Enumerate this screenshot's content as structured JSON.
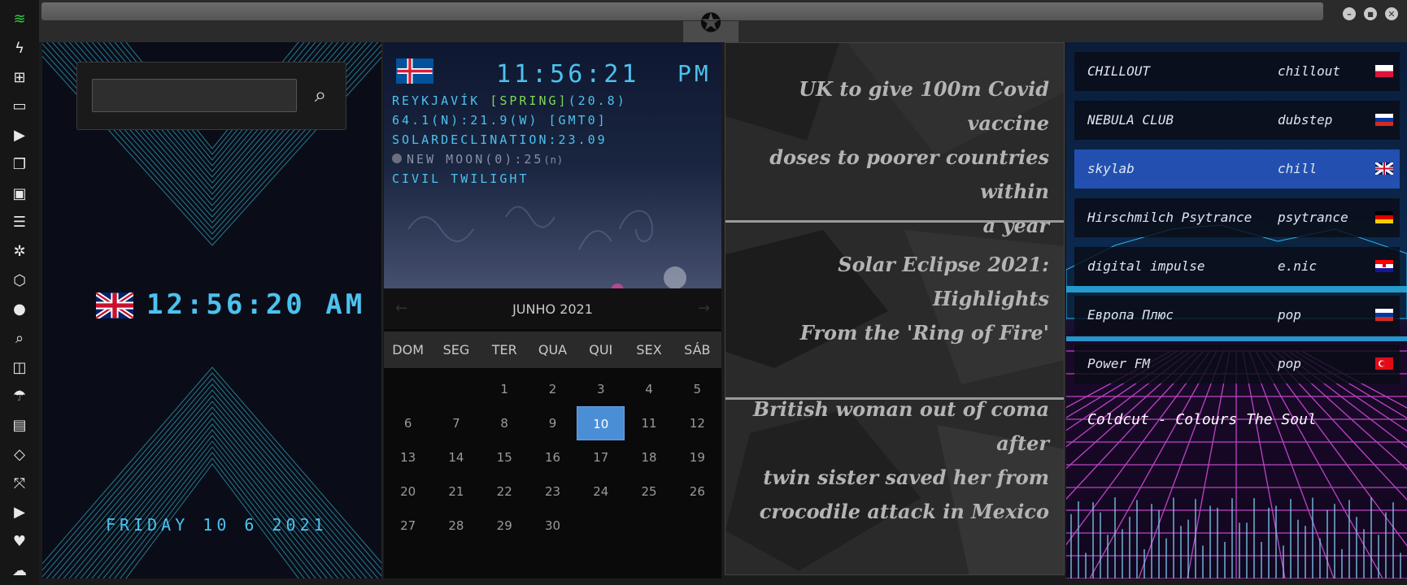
{
  "sidebar": {
    "items": [
      {
        "name": "wifi-icon",
        "glyph": "≋"
      },
      {
        "name": "power-icon",
        "glyph": "ϟ"
      },
      {
        "name": "windows-icon",
        "glyph": "⊞"
      },
      {
        "name": "archive-icon",
        "glyph": "▭"
      },
      {
        "name": "play-icon",
        "glyph": "▶"
      },
      {
        "name": "book-icon",
        "glyph": "❐"
      },
      {
        "name": "image-icon",
        "glyph": "▣"
      },
      {
        "name": "news-icon",
        "glyph": "☰"
      },
      {
        "name": "settings-icon",
        "glyph": "✲"
      },
      {
        "name": "hexagon-icon",
        "glyph": "⬡"
      },
      {
        "name": "globe-icon",
        "glyph": "●"
      },
      {
        "name": "search-icon",
        "glyph": "⌕"
      },
      {
        "name": "map-icon",
        "glyph": "◫"
      },
      {
        "name": "umbrella-icon",
        "glyph": "☂"
      },
      {
        "name": "contacts-icon",
        "glyph": "▤"
      },
      {
        "name": "code-icon",
        "glyph": "◇"
      },
      {
        "name": "fullscreen-icon",
        "glyph": "⤧"
      },
      {
        "name": "youtube-icon",
        "glyph": "▶"
      },
      {
        "name": "heart-icon",
        "glyph": "♥"
      },
      {
        "name": "cloud-icon",
        "glyph": "☁"
      }
    ]
  },
  "window": {
    "logo_glyph": "✪",
    "min_glyph": "–",
    "max_glyph": "■",
    "close_glyph": "✕"
  },
  "panel1": {
    "search": {
      "placeholder": "",
      "button_glyph": "⌕"
    },
    "clock": "12:56:20 AM",
    "date": "FRIDAY 10 6 2021"
  },
  "panel2": {
    "time": "11:56:21",
    "ampm": "PM",
    "city": "REYKJAVÍK",
    "season": "[SPRING]",
    "temp": "(20.8)",
    "coords": "64.1(N):21.9(W) [GMT0]",
    "declination": "SOLARDECLINATION:23.09",
    "moon": "NEW MOON(0):25",
    "moon_suffix": "(n)",
    "twilight": "CIVIL TWILIGHT",
    "calendar": {
      "month": "JUNHO 2021",
      "prev_glyph": "←",
      "next_glyph": "→",
      "weekdays": [
        "DOM",
        "SEG",
        "TER",
        "QUA",
        "QUI",
        "SEX",
        "SÁB"
      ],
      "weeks": [
        [
          "",
          "",
          "1",
          "2",
          "3",
          "4",
          "5"
        ],
        [
          "6",
          "7",
          "8",
          "9",
          "10",
          "11",
          "12"
        ],
        [
          "13",
          "14",
          "15",
          "16",
          "17",
          "18",
          "19"
        ],
        [
          "20",
          "21",
          "22",
          "23",
          "24",
          "25",
          "26"
        ],
        [
          "27",
          "28",
          "29",
          "30",
          "",
          "",
          ""
        ]
      ],
      "selected": "10"
    }
  },
  "news": {
    "items": [
      {
        "lines": [
          "UK to give 100m Covid vaccine",
          "doses to poorer countries within",
          "a year"
        ]
      },
      {
        "lines": [
          "Solar Eclipse 2021: Highlights",
          "From the 'Ring of Fire'"
        ]
      },
      {
        "lines": [
          "British woman out of coma after",
          "twin sister saved her from",
          "crocodile attack in Mexico"
        ]
      }
    ]
  },
  "radio": {
    "stations": [
      {
        "name": "CHILLOUT",
        "genre": "chillout",
        "flag": "pl"
      },
      {
        "name": "NEBULA CLUB",
        "genre": "dubstep",
        "flag": "ru"
      },
      {
        "name": "skylab",
        "genre": "chill",
        "flag": "gb"
      },
      {
        "name": "Hirschmilch Psytrance",
        "genre": "psytrance",
        "flag": "de"
      },
      {
        "name": "digital impulse",
        "genre": "e.nic",
        "flag": "hr"
      },
      {
        "name": "Европа Плюс",
        "genre": "pop",
        "flag": "ru"
      },
      {
        "name": "Power FM",
        "genre": "pop",
        "flag": "tr"
      }
    ],
    "selected_index": 2,
    "now_playing": "Coldcut - Colours The Soul"
  },
  "colors": {
    "accent": "#4cc2ee",
    "selected": "#4a8ed6",
    "wifi": "#2ecc40"
  }
}
